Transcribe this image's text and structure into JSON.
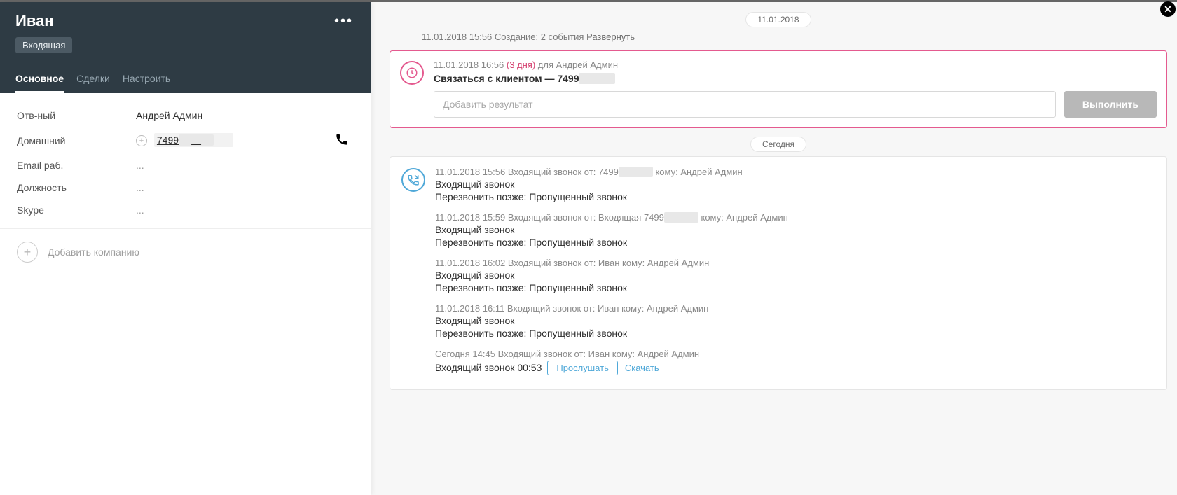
{
  "close_label": "✕",
  "contact": {
    "name": "Иван",
    "tag": "Входящая",
    "more_dots": "•••"
  },
  "tabs": {
    "main": "Основное",
    "deals": "Сделки",
    "settings": "Настроить"
  },
  "fields": {
    "responsible": {
      "label": "Отв-ный",
      "value": "Андрей Админ"
    },
    "home_phone": {
      "label": "Домашний",
      "value": "7499"
    },
    "email_work": {
      "label": "Email раб.",
      "value": "..."
    },
    "position": {
      "label": "Должность",
      "value": "..."
    },
    "skype": {
      "label": "Skype",
      "value": "..."
    }
  },
  "add_company": "Добавить компанию",
  "timeline": {
    "date_sep_1": "11.01.2018",
    "creation_text": "11.01.2018 15:56 Создание: 2 события ",
    "expand": "Развернуть",
    "task": {
      "time": "11.01.2018 16:56 ",
      "overdue": "(3 дня)",
      "for_text": " для Андрей Админ",
      "title": "Связаться с клиентом — 7499",
      "result_placeholder": "Добавить результат",
      "done_btn": "Выполнить"
    },
    "date_sep_2": "Сегодня",
    "calls": [
      {
        "meta_pre": "11.01.2018 15:56   Входящий звонок от: 7499",
        "meta_blur": true,
        "meta_post": " кому: Андрей Админ",
        "line1": "Входящий звонок",
        "line2": "Перезвонить позже: Пропущенный звонок"
      },
      {
        "meta_pre": "11.01.2018 15:59   Входящий звонок от: Входящая 7499",
        "meta_blur": true,
        "meta_post": " кому: Андрей Админ",
        "line1": "Входящий звонок",
        "line2": "Перезвонить позже: Пропущенный звонок"
      },
      {
        "meta_pre": "11.01.2018 16:02   Входящий звонок от: Иван кому: Андрей Админ",
        "meta_blur": false,
        "meta_post": "",
        "line1": "Входящий звонок",
        "line2": "Перезвонить позже: Пропущенный звонок"
      },
      {
        "meta_pre": "11.01.2018 16:11   Входящий звонок от: Иван кому: Андрей Админ",
        "meta_blur": false,
        "meta_post": "",
        "line1": "Входящий звонок",
        "line2": "Перезвонить позже: Пропущенный звонок"
      }
    ],
    "last_call": {
      "meta": "Сегодня 14:45   Входящий звонок от: Иван кому: Андрей Админ",
      "line1": "Входящий звонок 00:53",
      "listen": "Прослушать",
      "download": "Скачать"
    }
  }
}
